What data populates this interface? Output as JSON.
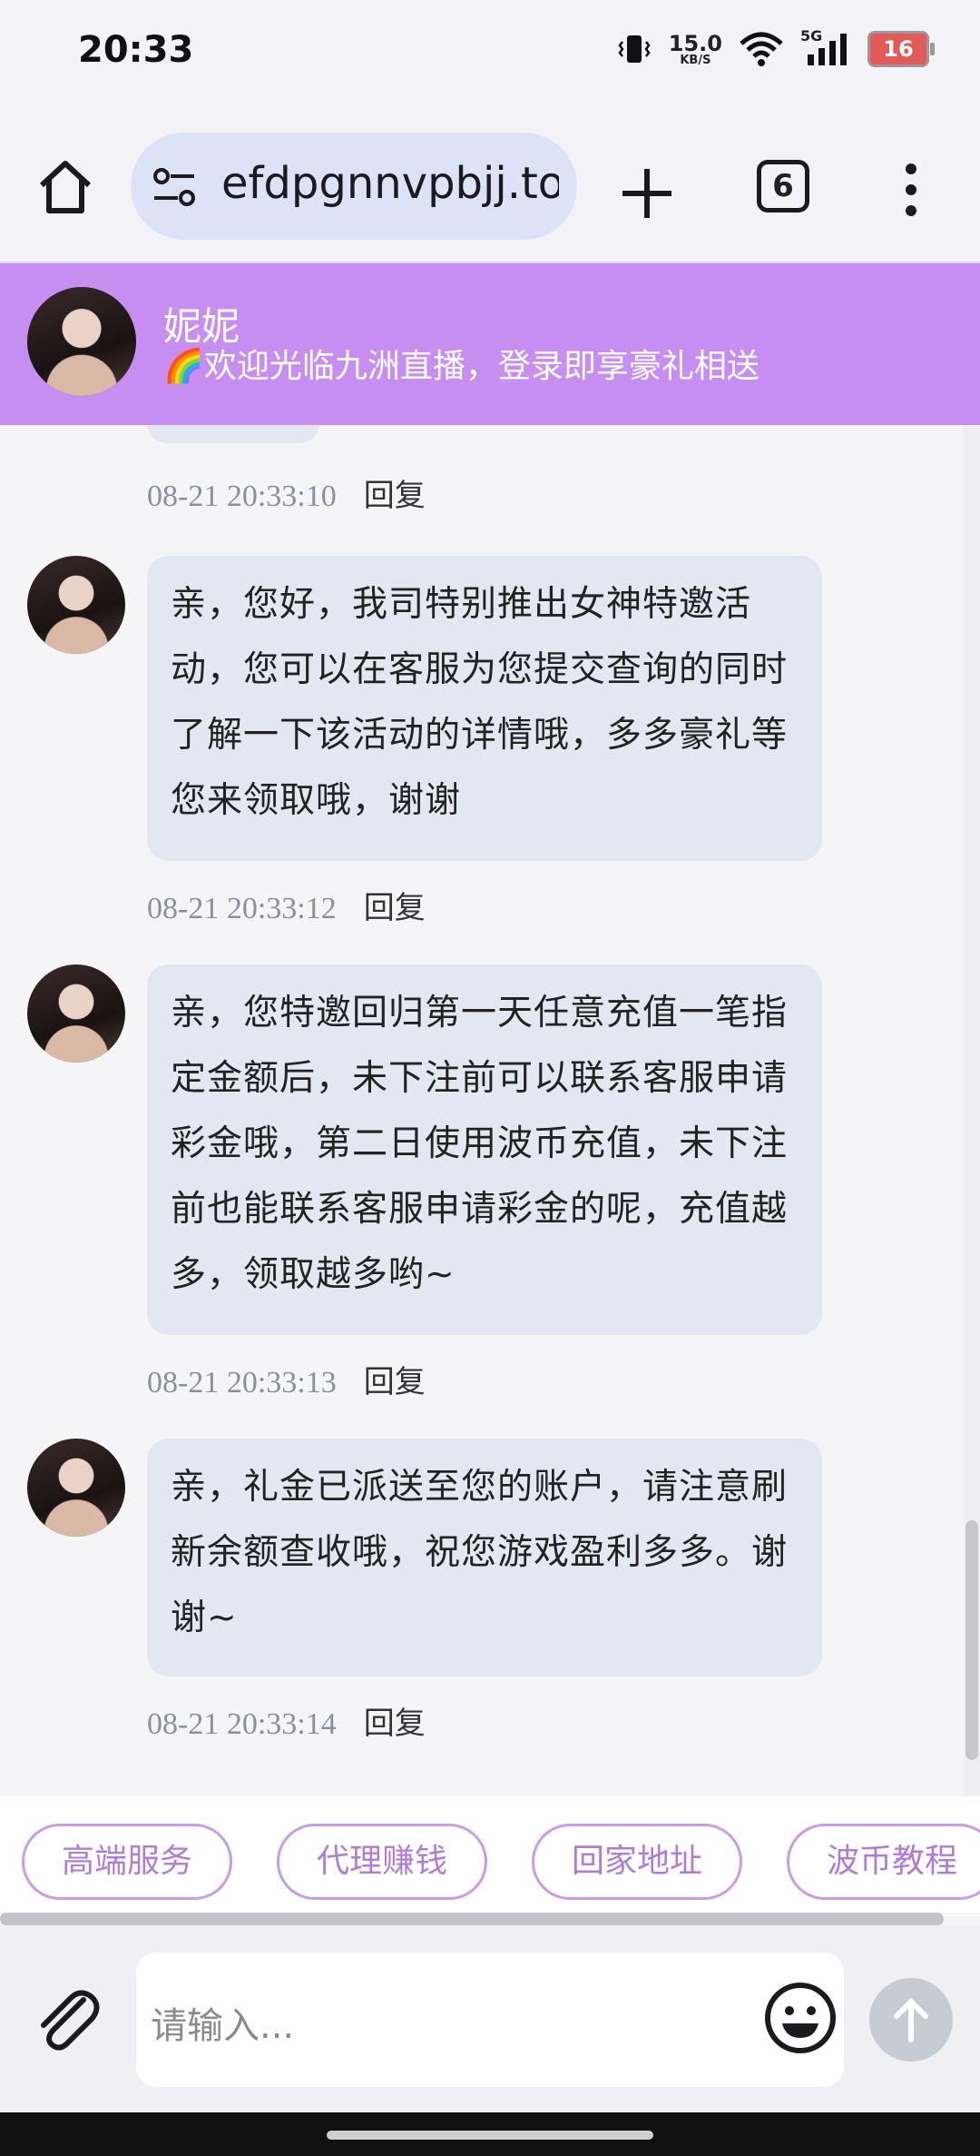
{
  "status_bar": {
    "time": "20:33",
    "speed_value": "15.0",
    "speed_unit": "KB/S",
    "network": "5G",
    "battery": "16"
  },
  "browser": {
    "url": "efdpgnnvpbjj.top",
    "tab_count": "6"
  },
  "chat_header": {
    "agent_name": "妮妮",
    "welcome": "🌈欢迎光临九洲直播，登录即享豪礼相送"
  },
  "messages": [
    {
      "time": "08-21 20:33:10",
      "reply": "回复"
    },
    {
      "text": "亲，您好，我司特别推出女神特邀活动，您可以在客服为您提交查询的同时了解一下该活动的详情哦，多多豪礼等您来领取哦，谢谢",
      "time": "08-21 20:33:12",
      "reply": "回复"
    },
    {
      "text": "亲，您特邀回归第一天任意充值一笔指定金额后，未下注前可以联系客服申请彩金哦，第二日使用波币充值，未下注前也能联系客服申请彩金的呢，充值越多，领取越多哟~",
      "time": "08-21 20:33:13",
      "reply": "回复"
    },
    {
      "text": "亲，礼金已派送至您的账户，请注意刷新余额查收哦，祝您游戏盈利多多。谢谢~",
      "time": "08-21 20:33:14",
      "reply": "回复"
    }
  ],
  "quick_chips": [
    "高端服务",
    "代理赚钱",
    "回家地址",
    "波币教程"
  ],
  "input": {
    "placeholder": "请输入..."
  },
  "colors": {
    "header": "#c78ef2",
    "bubble": "#e2e7f1",
    "chip": "#b07cd8"
  }
}
